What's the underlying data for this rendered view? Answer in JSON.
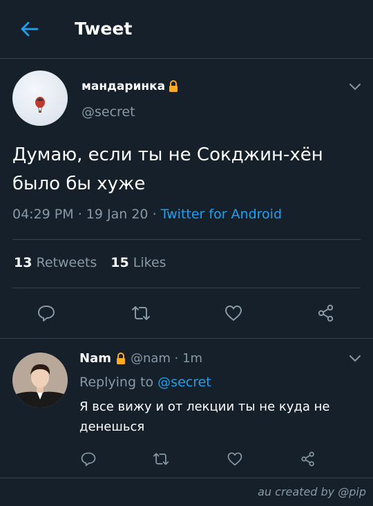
{
  "header": {
    "title": "Tweet"
  },
  "tweet": {
    "display_name": "мандаринка",
    "handle": "@secret",
    "text": "Думаю, если ты не Сокджин-хён было бы хуже",
    "time": "04:29 PM",
    "sep": "·",
    "date": "19 Jan 20",
    "source": "Twitter for Android",
    "retweets_count": "13",
    "retweets_label": "Retweets",
    "likes_count": "15",
    "likes_label": "Likes"
  },
  "reply": {
    "display_name": "Nam",
    "handle_time": "@nam · 1m",
    "replying_label": "Replying to",
    "replying_to": "@secret",
    "text": "Я все вижу и от лекции ты не куда не денешься"
  },
  "footer": {
    "credit": "au created by @pip"
  },
  "colors": {
    "background": "#15202b",
    "accent": "#1da1f2",
    "muted": "#8899a6",
    "border": "#38444d",
    "lock": "#ffad1f"
  }
}
